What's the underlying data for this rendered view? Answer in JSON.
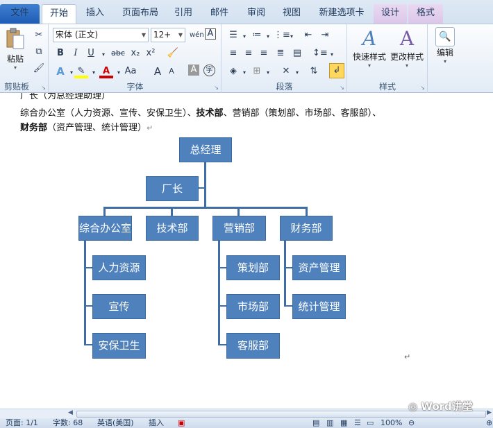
{
  "tabs": [
    "文件",
    "开始",
    "插入",
    "页面布局",
    "引用",
    "邮件",
    "审阅",
    "视图",
    "新建选项卡",
    "设计",
    "格式"
  ],
  "ribbon": {
    "clipboard": {
      "paste": "粘贴",
      "label": "剪贴板"
    },
    "font": {
      "name": "宋体 (正文)",
      "size": "12+",
      "label": "字体",
      "bold": "B",
      "italic": "I",
      "underline": "U",
      "strike": "abc",
      "sub": "x₂",
      "sup": "x²",
      "aa_grow": "A",
      "aa_shrink": "A",
      "case": "Aa",
      "char_shade": "A",
      "wen": "wén"
    },
    "paragraph": {
      "label": "段落"
    },
    "styles": {
      "quick": "快速样式",
      "change": "更改样式",
      "label": "样式"
    },
    "editing": {
      "edit": "编辑"
    }
  },
  "document": {
    "line0": "厂长（为总经理助理）",
    "line1_a": "综合办公室（人力资源、宣传、安保卫生）、",
    "line1_b": "技术部",
    "line1_c": "、营销部（策划部、市场部、客服部）、",
    "line2_a": "财务部",
    "line2_b": "（资产管理、统计管理）",
    "para_mark": "↵"
  },
  "org_chart": {
    "top": "总经理",
    "assistant": "厂长",
    "departments": [
      {
        "name": "综合办公室",
        "children": [
          "人力资源",
          "宣传",
          "安保卫生"
        ]
      },
      {
        "name": "技术部",
        "children": []
      },
      {
        "name": "营销部",
        "children": [
          "策划部",
          "市场部",
          "客服部"
        ]
      },
      {
        "name": "财务部",
        "children": [
          "资产管理",
          "统计管理"
        ]
      }
    ]
  },
  "statusbar": {
    "page": "页面: 1/1",
    "words": "字数: 68",
    "lang": "英语(美国)",
    "mode": "插入",
    "zoom": "100%"
  },
  "watermark": "Word讲堂",
  "colors": {
    "box": "#4f81bd",
    "file_tab": "#2a64b8",
    "ribbon_bg": "#e2ebf6"
  }
}
